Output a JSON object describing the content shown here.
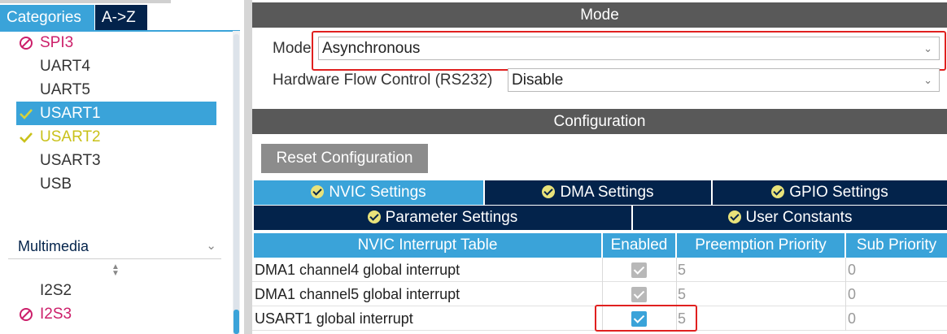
{
  "left_panel": {
    "tabs": {
      "categories": "Categories",
      "az": "A->Z"
    },
    "items": [
      {
        "label": "SPI3",
        "status": "disabled"
      },
      {
        "label": "UART4",
        "status": "none"
      },
      {
        "label": "UART5",
        "status": "none"
      },
      {
        "label": "USART1",
        "status": "ok",
        "selected": true
      },
      {
        "label": "USART2",
        "status": "ok"
      },
      {
        "label": "USART3",
        "status": "none"
      },
      {
        "label": "USB",
        "status": "none"
      }
    ],
    "multimedia": {
      "label": "Multimedia"
    },
    "multimedia_items": [
      {
        "label": "I2S2",
        "status": "none"
      },
      {
        "label": "I2S3",
        "status": "disabled"
      }
    ]
  },
  "mode_section": {
    "header": "Mode",
    "mode_label": "Mode",
    "mode_value": "Asynchronous",
    "flow_label": "Hardware Flow Control (RS232)",
    "flow_value": "Disable"
  },
  "config_section": {
    "header": "Configuration",
    "reset_button": "Reset Configuration",
    "tabs": {
      "nvic": "NVIC Settings",
      "dma": "DMA Settings",
      "gpio": "GPIO Settings",
      "param": "Parameter Settings",
      "user": "User Constants"
    },
    "table": {
      "headers": {
        "name": "NVIC Interrupt Table",
        "enabled": "Enabled",
        "preemption": "Preemption Priority",
        "sub": "Sub Priority"
      },
      "rows": [
        {
          "name": "DMA1 channel4 global interrupt",
          "enabled": true,
          "preemption": "5",
          "sub": "0"
        },
        {
          "name": "DMA1 channel5 global interrupt",
          "enabled": true,
          "preemption": "5",
          "sub": "0"
        },
        {
          "name": "USART1 global interrupt",
          "enabled": true,
          "preemption": "5",
          "sub": "0"
        }
      ]
    }
  },
  "colors": {
    "accent": "#3aa3d9",
    "dark_navy": "#03234b",
    "header_grey": "#595959",
    "highlight_red": "#e0201f",
    "disabled_magenta": "#cc1f6a",
    "ok_yellow": "#c9c11a"
  }
}
